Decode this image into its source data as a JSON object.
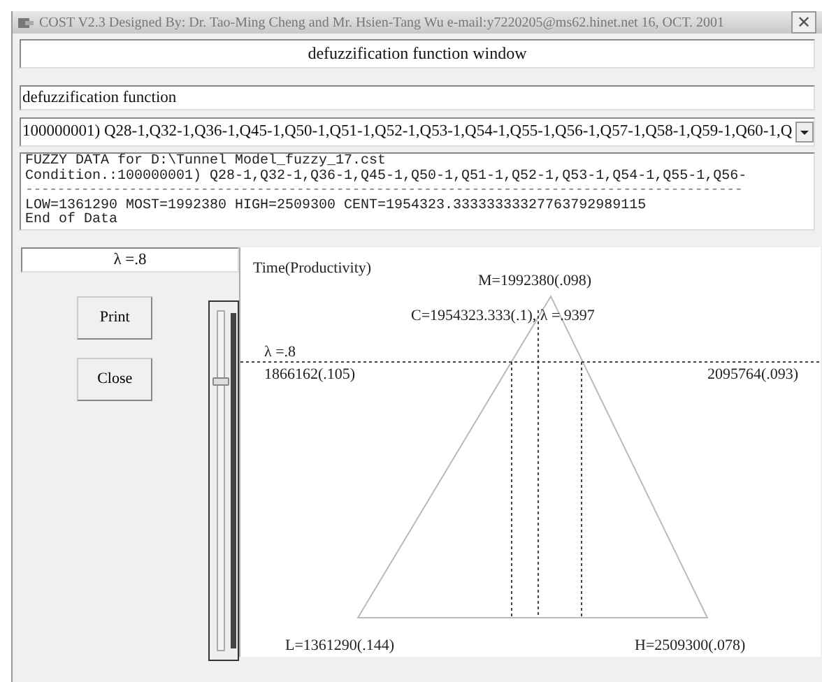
{
  "window": {
    "title": "COST  V2.3  Designed By: Dr. Tao-Ming Cheng  and Mr. Hsien-Tang Wu   e-mail:y7220205@ms62.hinet.net  16, OCT.  2001",
    "close": "✕"
  },
  "heading": "defuzzification function window",
  "function_label": "defuzzification function",
  "condition_select": {
    "value": "100000001) Q28-1,Q32-1,Q36-1,Q45-1,Q50-1,Q51-1,Q52-1,Q53-1,Q54-1,Q55-1,Q56-1,Q57-1,Q58-1,Q59-1,Q60-1,Q"
  },
  "output_lines": [
    {
      "kind": "text",
      "text": "FUZZY DATA for D:\\Tunnel Model_fuzzy_17.cst"
    },
    {
      "kind": "text",
      "text": "Condition.:100000001) Q28-1,Q32-1,Q36-1,Q45-1,Q50-1,Q51-1,Q52-1,Q53-1,Q54-1,Q55-1,Q56-"
    },
    {
      "kind": "rule",
      "text": "------------------------------------------------------------------------------------------"
    },
    {
      "kind": "text",
      "text": "LOW=1361290 MOST=1992380 HIGH=2509300 CENT=1954323.33333333327763792989115"
    },
    {
      "kind": "text",
      "text": "End of Data"
    }
  ],
  "lambda_display": "λ =.8",
  "buttons": [
    "Print",
    "Close"
  ],
  "lambda_slider": {
    "level": 0.8
  },
  "chart": {
    "title": "Time(Productivity)",
    "most_label": "M=1992380(.098)",
    "center_label": "C=1954323.333(.1),  λ =.9397",
    "cut_label": "λ =.8",
    "cut_left_label": "1866162(.105)",
    "cut_right_label": "2095764(.093)",
    "low_label": "L=1361290(.144)",
    "high_label": "H=2509300(.078)"
  }
}
